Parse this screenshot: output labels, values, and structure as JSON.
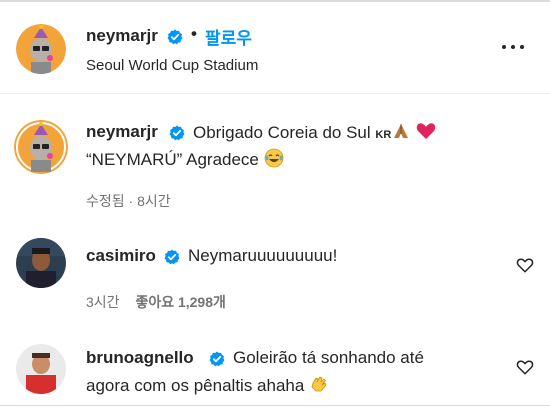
{
  "header": {
    "username": "neymarjr",
    "separator": "•",
    "follow_label": "팔로우",
    "location": "Seoul World Cup Stadium"
  },
  "caption": {
    "username": "neymarjr",
    "text_line1": "Obrigado Coreia do Sul",
    "flag_text": "KR",
    "text_line2": "“NEYMARÚ” Agradece",
    "meta": "수정됨 · 8시간"
  },
  "comments": [
    {
      "username": "casimiro",
      "text": "Neymaruuuuuuuuu!",
      "time": "3시간",
      "likes": "좋아요 1,298개"
    },
    {
      "username": "brunoagnello",
      "text_line1": "Goleirão tá sonhando até",
      "text_line2": "agora com os pênaltis ahaha"
    }
  ],
  "icons": {
    "verified": "verified-badge-icon",
    "more": "more-options-icon",
    "like": "heart-outline-icon"
  },
  "colors": {
    "accent": "#0095f6",
    "verified": "#0095f6",
    "secondary_text": "#737373"
  }
}
